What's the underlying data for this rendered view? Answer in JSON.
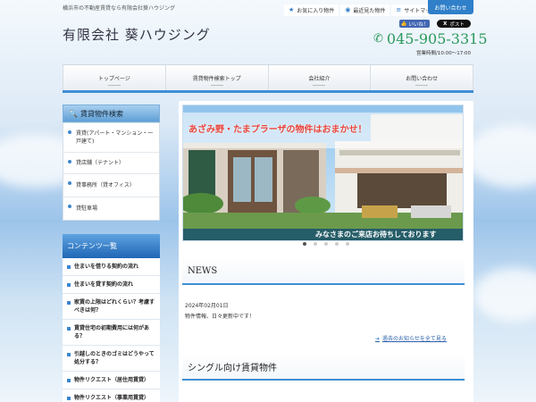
{
  "header": {
    "tagline": "横浜市の不動産賃貸なら有限会社葵ハウジング",
    "logo": "有限会社 葵ハウジング",
    "links": [
      {
        "icon": "star-icon",
        "label": "お気に入り物件"
      },
      {
        "icon": "eye-icon",
        "label": "最近見た物件"
      },
      {
        "icon": "sitemap-icon",
        "label": "サイトマップ"
      }
    ],
    "contact_label": "お問い合わせ",
    "facebook_label": "いいね！",
    "x_label": "ポスト",
    "phone": "045-905-3315",
    "hours": "営業時間/10:00～17:00"
  },
  "nav": [
    "トップページ",
    "賃貸物件検索トップ",
    "会社紹介",
    "お問い合わせ"
  ],
  "sidebar": {
    "search_title": "賃貸物件検索",
    "search_items": [
      "賃貸(アパート・マンション・一戸建て)",
      "貸店舗（テナント）",
      "貸事務所（貸オフィス）",
      "貸駐車場"
    ],
    "content_title": "コンテンツ一覧",
    "content_items": [
      "住まいを借りる契約の流れ",
      "住まいを貸す契約の流れ",
      "家賃の上限はどれくらい？考慮すべきは何？",
      "賃貸住宅の初期費用には何がある？",
      "引越しのときのゴミはどうやって処分する？",
      "物件リクエスト（居住用賃貸）",
      "物件リクエスト（事業用賃貸）"
    ]
  },
  "hero": {
    "banner_text": "あざみ野・たまプラーザの物件はおまかせ！",
    "caption": "みなさまのご来店お待ちしております",
    "slides": 5,
    "active_slide": 0
  },
  "news": {
    "title": "NEWS",
    "date": "2024年02月01日",
    "text": "物件情報、日々更新中です！",
    "more_label": "過去のお知らせを全て見る"
  },
  "section2_title": "シングル向け賃貸物件",
  "colors": {
    "accent": "#3f8fd6",
    "phone": "#2a9a5c"
  }
}
